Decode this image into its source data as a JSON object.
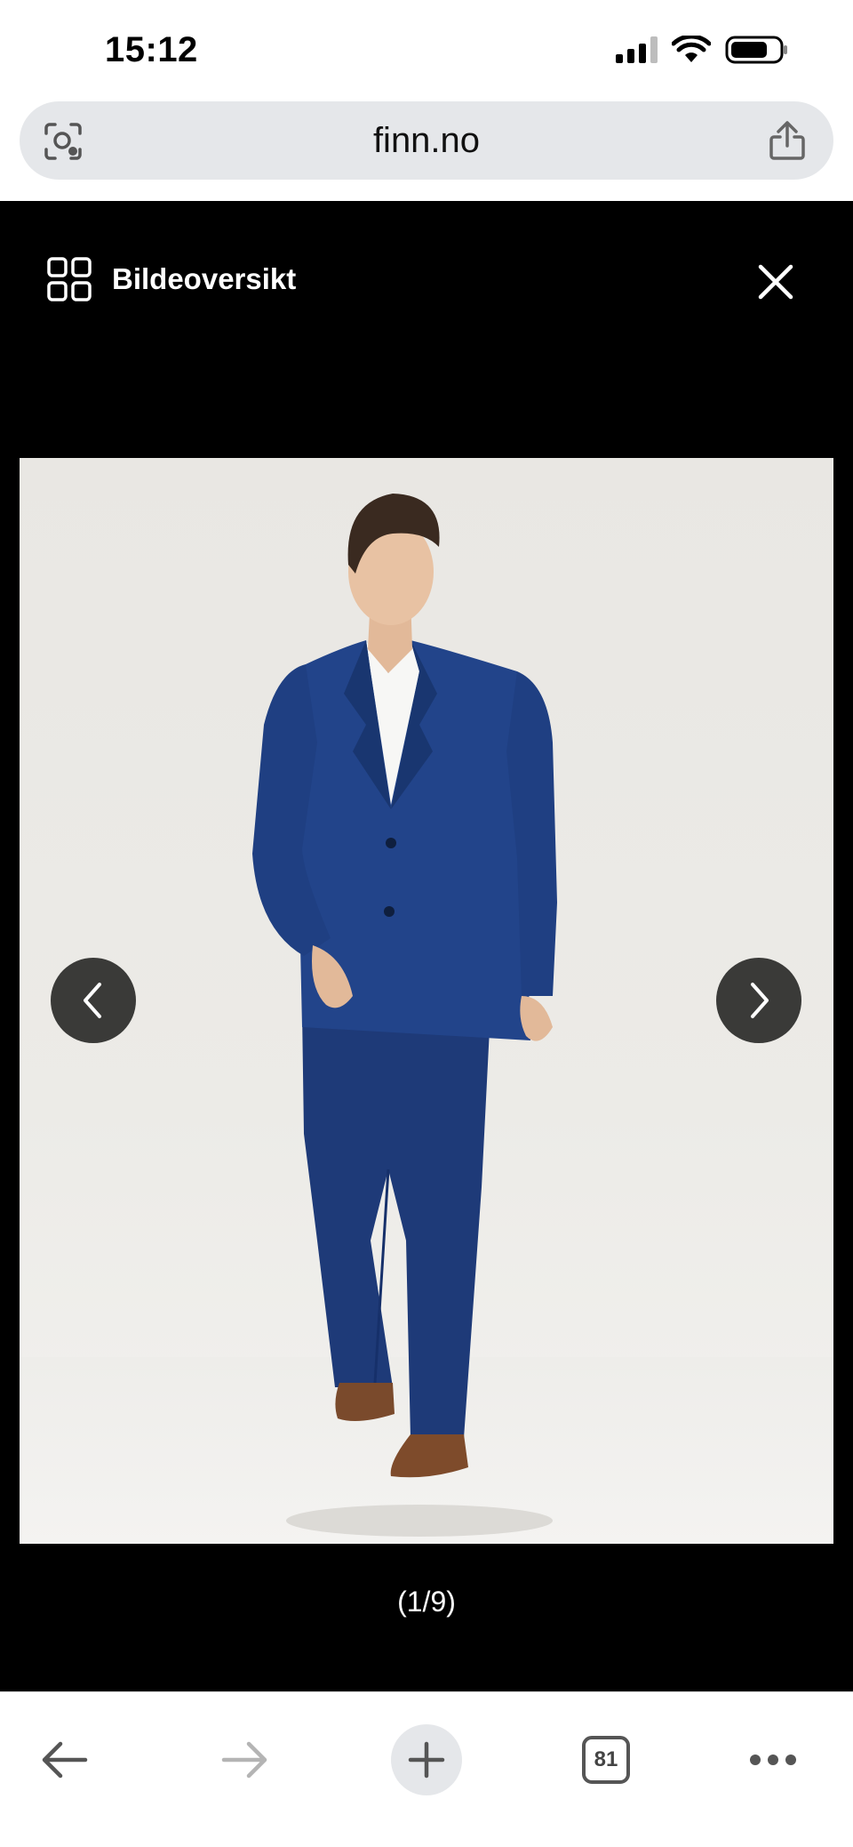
{
  "status_bar": {
    "time": "15:12"
  },
  "browser": {
    "url": "finn.no"
  },
  "viewer": {
    "overview_label": "Bildeoversikt",
    "counter": "(1/9)"
  },
  "toolbar": {
    "tab_count": "81"
  },
  "colors": {
    "viewer_background": "#000000",
    "suit": "#1f3f7f",
    "nav_button": "#3a3a38",
    "address_bar": "#e5e7ea"
  },
  "icons": {
    "address_left": "camera-search-icon",
    "address_right": "share-icon",
    "overview": "grid-icon",
    "close": "close-icon",
    "prev": "chevron-left-icon",
    "next": "chevron-right-icon",
    "back": "arrow-left-icon",
    "forward": "arrow-right-icon",
    "new_tab": "plus-icon",
    "more": "more-icon"
  }
}
